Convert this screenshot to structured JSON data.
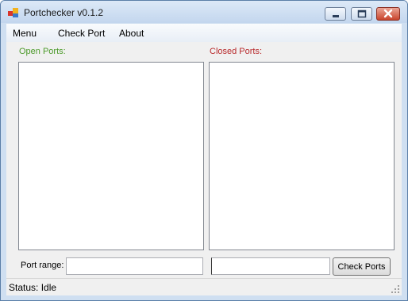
{
  "window": {
    "title": "Portchecker v0.1.2"
  },
  "controls": {
    "minimize_icon": "minimize-icon",
    "maximize_icon": "maximize-icon",
    "close_icon": "close-icon"
  },
  "menu": {
    "items": [
      "Menu",
      "Check Port",
      "About"
    ]
  },
  "lists": {
    "open_label": "Open Ports:",
    "closed_label": "Closed Ports:",
    "open_color": "#4c9a2a",
    "closed_color": "#b8292b"
  },
  "port_range": {
    "label": "Port range:",
    "from_value": "",
    "to_value": ""
  },
  "button": {
    "check_label": "Check Ports"
  },
  "status": {
    "text": "Status: Idle"
  }
}
